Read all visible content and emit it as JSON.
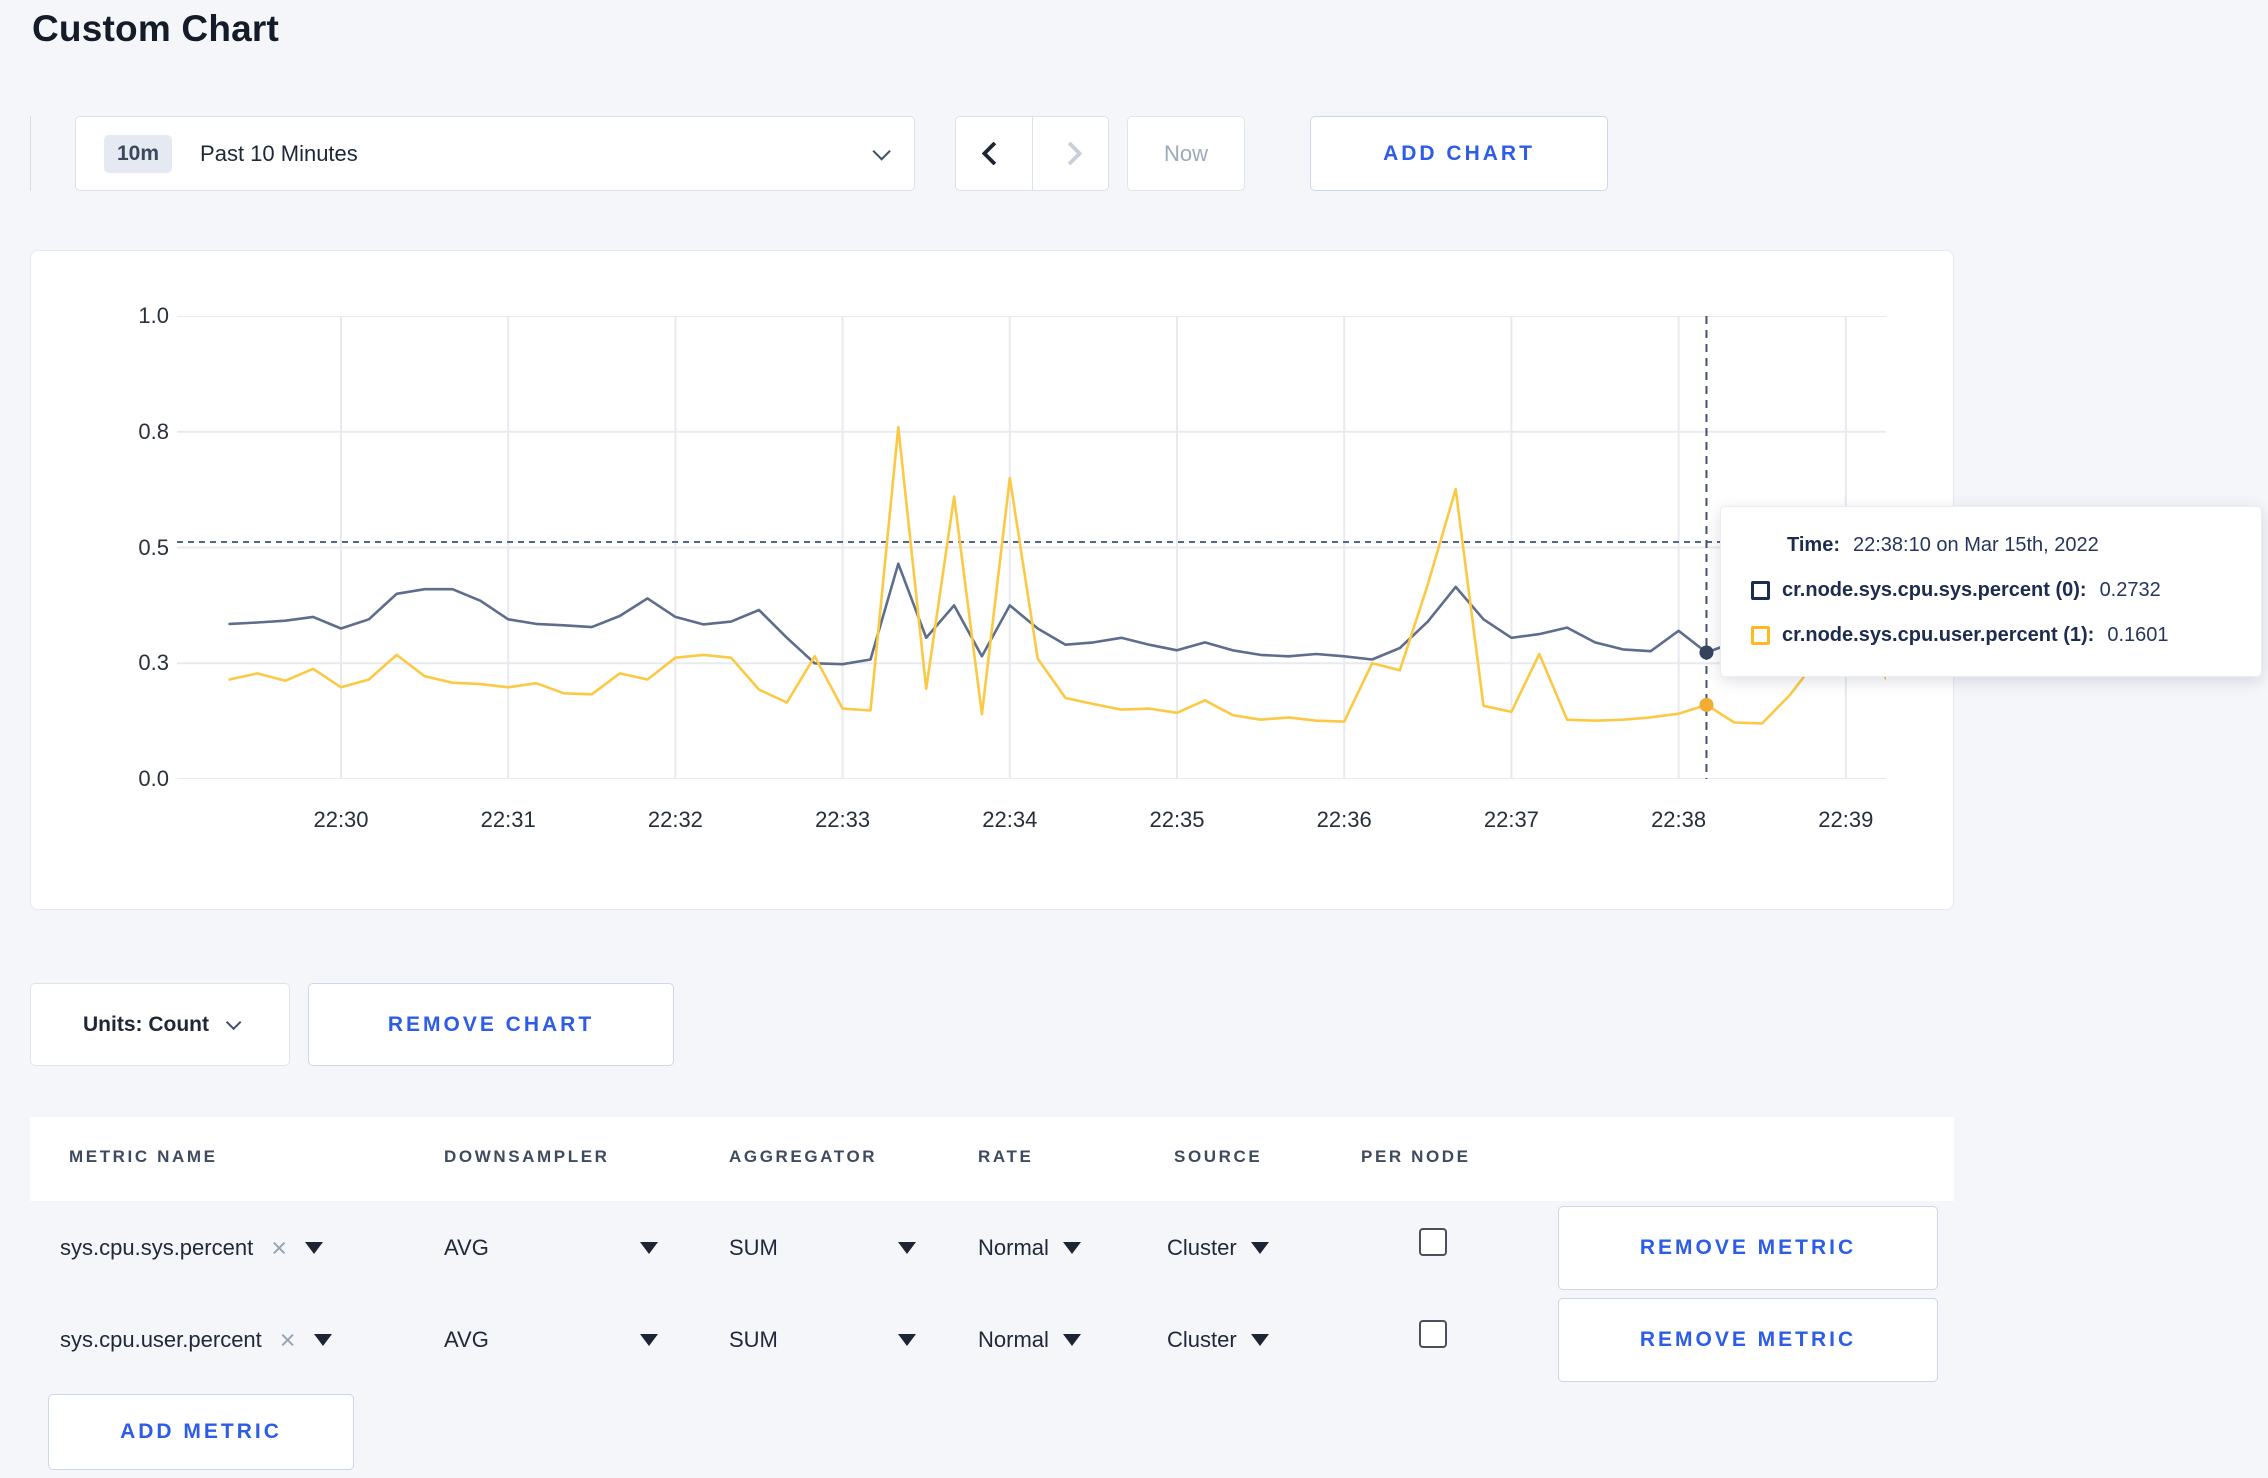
{
  "page": {
    "title": "Custom Chart"
  },
  "toolbar": {
    "time_window": {
      "badge": "10m",
      "label": "Past 10 Minutes"
    },
    "now_label": "Now",
    "add_chart_label": "ADD CHART"
  },
  "colors": {
    "accent_blue": "#2d5ce6",
    "series_sys_line": "#5e6d8c",
    "series_user_line": "#fcc944",
    "legend_sys": "#1d2c4e",
    "legend_user": "#fdbb1f",
    "gridline": "#e8eaef",
    "hover_line": "#56678a"
  },
  "chart": {
    "tooltip": {
      "time_label": "Time:",
      "time_value": "22:38:10 on Mar 15th, 2022",
      "series": [
        {
          "label": "cr.node.sys.cpu.sys.percent (0):",
          "value": "0.2732",
          "color": "#1d2c4e"
        },
        {
          "label": "cr.node.sys.cpu.user.percent (1):",
          "value": "0.1601",
          "color": "#fdbb1f"
        }
      ]
    }
  },
  "chart_data": {
    "type": "line",
    "title": "",
    "xlabel": "",
    "ylabel": "",
    "ylim": [
      0,
      1
    ],
    "grid": true,
    "legend_position": "tooltip-overlay",
    "y_tick_labels": [
      "1.0",
      "0.8",
      "0.5",
      "0.3",
      "0.0"
    ],
    "y_tick_values": [
      1.0,
      0.75,
      0.5,
      0.25,
      0.0
    ],
    "x_tick_labels": [
      "22:30",
      "22:31",
      "22:32",
      "22:33",
      "22:34",
      "22:35",
      "22:36",
      "22:37",
      "22:38",
      "22:39"
    ],
    "x_start": "22:29:20",
    "x_step_seconds": 10,
    "hover": {
      "time": "22:38:10",
      "index": 53,
      "crosshair_y_value": 0.512
    },
    "series": [
      {
        "name": "cr.node.sys.cpu.sys.percent (0)",
        "color": "#5e6d8c",
        "dot_color": "#35435e",
        "hover_value": 0.2732,
        "values": [
          0.335,
          0.338,
          0.342,
          0.35,
          0.325,
          0.345,
          0.4,
          0.41,
          0.41,
          0.385,
          0.345,
          0.335,
          0.332,
          0.328,
          0.352,
          0.39,
          0.35,
          0.334,
          0.34,
          0.365,
          0.305,
          0.25,
          0.248,
          0.258,
          0.465,
          0.305,
          0.375,
          0.265,
          0.375,
          0.325,
          0.29,
          0.295,
          0.305,
          0.29,
          0.278,
          0.295,
          0.278,
          0.268,
          0.265,
          0.27,
          0.265,
          0.258,
          0.283,
          0.34,
          0.415,
          0.345,
          0.305,
          0.313,
          0.327,
          0.295,
          0.28,
          0.276,
          0.32,
          0.2732,
          0.295,
          0.305,
          0.29,
          0.295,
          0.305,
          0.295,
          0.29
        ]
      },
      {
        "name": "cr.node.sys.cpu.user.percent (1)",
        "color": "#fcc944",
        "dot_color": "#f3ac32",
        "hover_value": 0.1601,
        "values": [
          0.215,
          0.228,
          0.212,
          0.238,
          0.198,
          0.215,
          0.268,
          0.222,
          0.208,
          0.205,
          0.198,
          0.207,
          0.185,
          0.183,
          0.228,
          0.215,
          0.262,
          0.268,
          0.262,
          0.193,
          0.165,
          0.265,
          0.152,
          0.148,
          0.76,
          0.195,
          0.61,
          0.14,
          0.65,
          0.26,
          0.175,
          0.162,
          0.15,
          0.152,
          0.143,
          0.17,
          0.138,
          0.128,
          0.133,
          0.126,
          0.124,
          0.25,
          0.235,
          0.42,
          0.626,
          0.158,
          0.145,
          0.27,
          0.128,
          0.126,
          0.128,
          0.133,
          0.141,
          0.1601,
          0.122,
          0.12,
          0.182,
          0.26,
          0.23,
          0.255,
          0.17
        ]
      }
    ]
  },
  "chart_controls": {
    "units_label": "Units: Count",
    "remove_chart_label": "REMOVE CHART"
  },
  "metrics_table": {
    "headers": [
      "METRIC NAME",
      "DOWNSAMPLER",
      "AGGREGATOR",
      "RATE",
      "SOURCE",
      "PER NODE"
    ],
    "rows": [
      {
        "metric": "sys.cpu.sys.percent",
        "downsampler": "AVG",
        "aggregator": "SUM",
        "rate": "Normal",
        "source": "Cluster",
        "per_node_checked": false,
        "remove_label": "REMOVE METRIC"
      },
      {
        "metric": "sys.cpu.user.percent",
        "downsampler": "AVG",
        "aggregator": "SUM",
        "rate": "Normal",
        "source": "Cluster",
        "per_node_checked": false,
        "remove_label": "REMOVE METRIC"
      }
    ],
    "add_metric_label": "ADD METRIC"
  }
}
